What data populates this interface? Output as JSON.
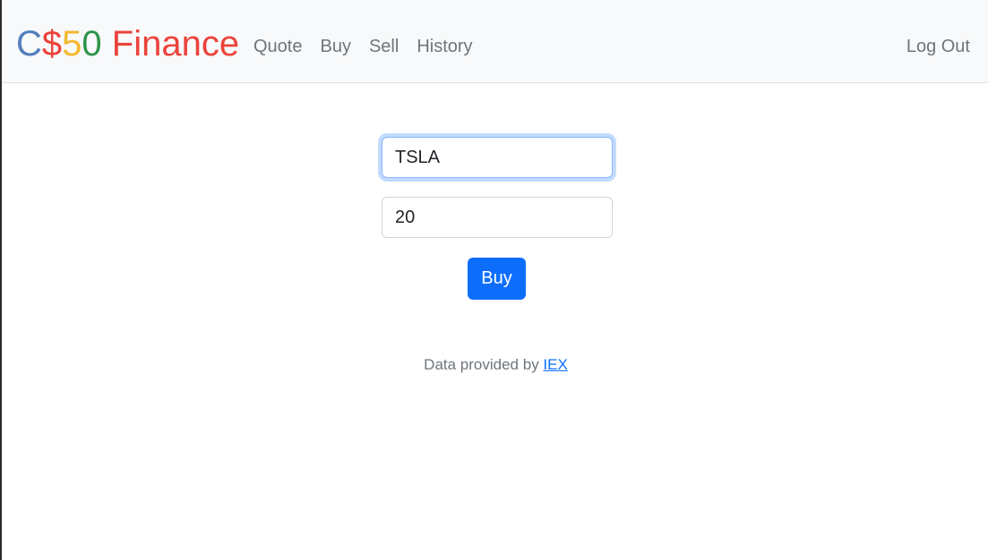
{
  "navbar": {
    "brand": {
      "parts": [
        {
          "text": "C",
          "color": "#537fbe"
        },
        {
          "text": "$",
          "color": "#ea433b"
        },
        {
          "text": "5",
          "color": "#f5b82e"
        },
        {
          "text": "0",
          "color": "#2e944b"
        },
        {
          "text": " Finance",
          "color": "#ea433b"
        }
      ]
    },
    "links": [
      "Quote",
      "Buy",
      "Sell",
      "History"
    ],
    "logout_label": "Log Out"
  },
  "form": {
    "symbol_value": "TSLA",
    "shares_value": "20",
    "submit_label": "Buy"
  },
  "footer": {
    "prefix": "Data provided by ",
    "link_text": "IEX"
  },
  "colors": {
    "accent": "#0d6efd",
    "navbar_bg": "#f8f9fa",
    "muted_text": "#6c757d"
  }
}
